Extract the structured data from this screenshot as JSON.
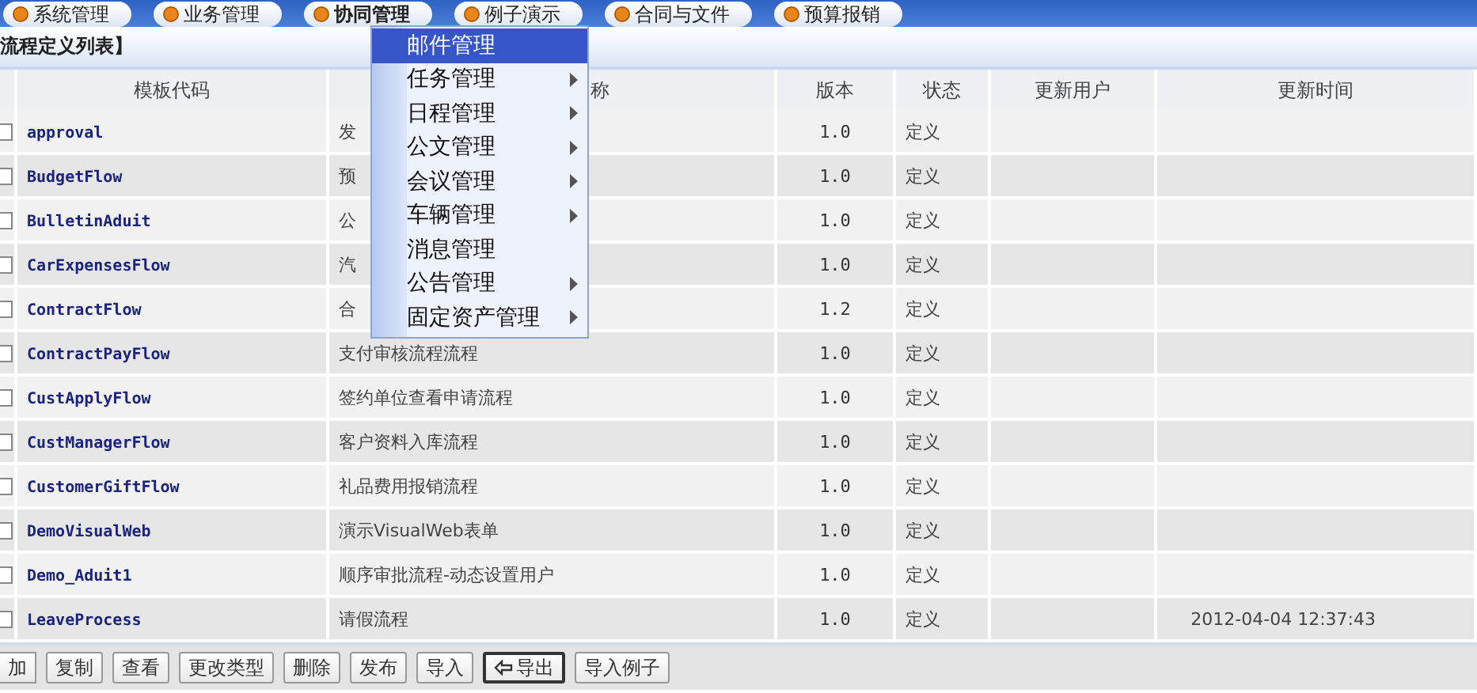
{
  "tabs": [
    {
      "label": "系统管理",
      "selected": false
    },
    {
      "label": "业务管理",
      "selected": false
    },
    {
      "label": "协同管理",
      "selected": true
    },
    {
      "label": "例子演示",
      "selected": false
    },
    {
      "label": "合同与文件",
      "selected": false
    },
    {
      "label": "预算报销",
      "selected": false
    }
  ],
  "panel_title": "流程定义列表】",
  "table": {
    "columns": [
      "模板代码",
      "称",
      "版本",
      "状态",
      "更新用户",
      "更新时间"
    ],
    "rows": [
      {
        "checked": false,
        "code": "approval",
        "name": "发",
        "version": "1.0",
        "state": "定义",
        "user": "",
        "time": ""
      },
      {
        "checked": false,
        "code": "BudgetFlow",
        "name": "预",
        "version": "1.0",
        "state": "定义",
        "user": "",
        "time": ""
      },
      {
        "checked": false,
        "code": "BulletinAduit",
        "name": "公",
        "version": "1.0",
        "state": "定义",
        "user": "",
        "time": ""
      },
      {
        "checked": false,
        "code": "CarExpensesFlow",
        "name": "汽",
        "version": "1.0",
        "state": "定义",
        "user": "",
        "time": ""
      },
      {
        "checked": false,
        "code": "ContractFlow",
        "name": "合",
        "version": "1.2",
        "state": "定义",
        "user": "",
        "time": ""
      },
      {
        "checked": false,
        "code": "ContractPayFlow",
        "name": "支付审核流程流程",
        "version": "1.0",
        "state": "定义",
        "user": "",
        "time": ""
      },
      {
        "checked": false,
        "code": "CustApplyFlow",
        "name": "签约单位查看申请流程",
        "version": "1.0",
        "state": "定义",
        "user": "",
        "time": ""
      },
      {
        "checked": false,
        "code": "CustManagerFlow",
        "name": "客户资料入库流程",
        "version": "1.0",
        "state": "定义",
        "user": "",
        "time": ""
      },
      {
        "checked": false,
        "code": "CustomerGiftFlow",
        "name": "礼品费用报销流程",
        "version": "1.0",
        "state": "定义",
        "user": "",
        "time": ""
      },
      {
        "checked": false,
        "code": "DemoVisualWeb",
        "name": "演示VisualWeb表单",
        "version": "1.0",
        "state": "定义",
        "user": "",
        "time": ""
      },
      {
        "checked": false,
        "code": "Demo_Aduit1",
        "name": "顺序审批流程-动态设置用户",
        "version": "1.0",
        "state": "定义",
        "user": "",
        "time": ""
      },
      {
        "checked": false,
        "code": "LeaveProcess",
        "name": "请假流程",
        "version": "1.0",
        "state": "定义",
        "user": "",
        "time": "2012-04-04 12:37:43"
      }
    ]
  },
  "toolbar": [
    {
      "label": "加",
      "kind": "plain"
    },
    {
      "label": "复制",
      "kind": "plain"
    },
    {
      "label": "查看",
      "kind": "plain"
    },
    {
      "label": "更改类型",
      "kind": "plain"
    },
    {
      "label": "删除",
      "kind": "plain"
    },
    {
      "label": "发布",
      "kind": "plain"
    },
    {
      "label": "导入",
      "kind": "plain"
    },
    {
      "label": "导出",
      "kind": "export"
    },
    {
      "label": "导入例子",
      "kind": "plain"
    }
  ],
  "menu": [
    {
      "label": "邮件管理",
      "selected": true,
      "submenu": false
    },
    {
      "label": "任务管理",
      "selected": false,
      "submenu": true
    },
    {
      "label": "日程管理",
      "selected": false,
      "submenu": true
    },
    {
      "label": "公文管理",
      "selected": false,
      "submenu": true
    },
    {
      "label": "会议管理",
      "selected": false,
      "submenu": true
    },
    {
      "label": "车辆管理",
      "selected": false,
      "submenu": true
    },
    {
      "label": "消息管理",
      "selected": false,
      "submenu": false
    },
    {
      "label": "公告管理",
      "selected": false,
      "submenu": true
    },
    {
      "label": "固定资产管理",
      "selected": false,
      "submenu": true
    }
  ]
}
